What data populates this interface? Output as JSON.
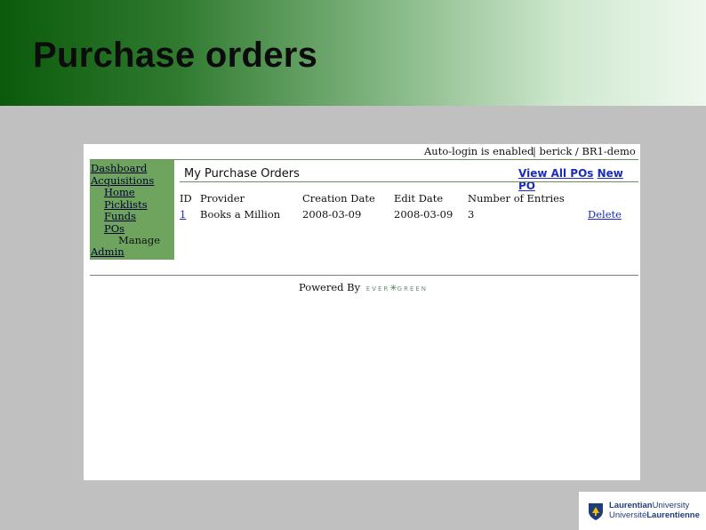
{
  "slide": {
    "title": "Purchase orders"
  },
  "topbar": {
    "autologin": "Auto-login is enabled",
    "user": "| berick / BR1-demo"
  },
  "sidebar": {
    "items": [
      {
        "label": "Dashboard",
        "indent": 0,
        "link": true
      },
      {
        "label": "Acquisitions",
        "indent": 0,
        "link": true
      },
      {
        "label": "Home",
        "indent": 1,
        "link": true
      },
      {
        "label": "Picklists",
        "indent": 1,
        "link": true
      },
      {
        "label": "Funds",
        "indent": 1,
        "link": true
      },
      {
        "label": "POs",
        "indent": 1,
        "link": true
      },
      {
        "label": "Manage",
        "indent": 2,
        "link": false
      },
      {
        "label": "Admin",
        "indent": 0,
        "link": true
      }
    ]
  },
  "main": {
    "heading": "My Purchase Orders",
    "view_all": "View All POs",
    "new_po": "New PO",
    "columns": [
      "ID",
      "Provider",
      "Creation Date",
      "Edit Date",
      "Number of Entries"
    ],
    "rows": [
      {
        "id": "1",
        "provider": "Books a Million",
        "creation_date": "2008-03-09",
        "edit_date": "2008-03-09",
        "entries": "3",
        "action": "Delete"
      }
    ]
  },
  "footer": {
    "powered_by": "Powered By",
    "brand_left": "EVER",
    "brand_right": "GREEN"
  },
  "logo": {
    "line1_bold": "Laurentian",
    "line1_rest": "University",
    "line2_rest": "Université",
    "line2_bold": "Laurentienne"
  }
}
